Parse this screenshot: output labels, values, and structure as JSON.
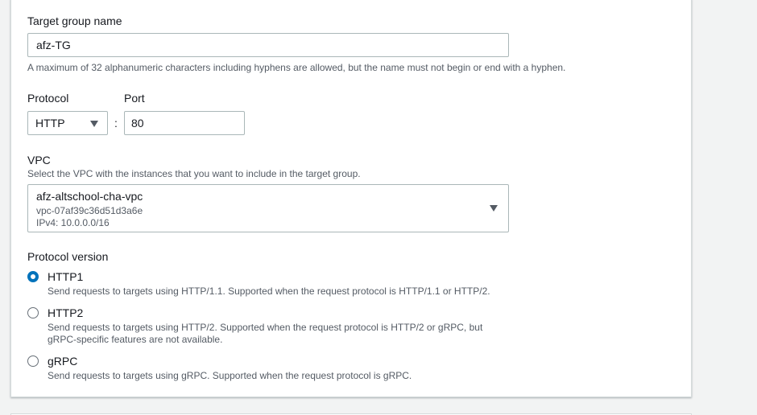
{
  "target_group_name": {
    "label": "Target group name",
    "value": "afz-TG",
    "hint": "A maximum of 32 alphanumeric characters including hyphens are allowed, but the name must not begin or end with a hyphen."
  },
  "protocol": {
    "label": "Protocol",
    "value": "HTTP"
  },
  "separator": ":",
  "port": {
    "label": "Port",
    "value": "80"
  },
  "vpc": {
    "label": "VPC",
    "hint": "Select the VPC with the instances that you want to include in the target group.",
    "selected_name": "afz-altschool-cha-vpc",
    "selected_id": "vpc-07af39c36d51d3a6e",
    "selected_cidr": "IPv4: 10.0.0.0/16"
  },
  "protocol_version": {
    "label": "Protocol version",
    "options": [
      {
        "label": "HTTP1",
        "description": "Send requests to targets using HTTP/1.1. Supported when the request protocol is HTTP/1.1 or HTTP/2.",
        "checked": true
      },
      {
        "label": "HTTP2",
        "description_line1": "Send requests to targets using HTTP/2. Supported when the request protocol is HTTP/2 or gRPC, but",
        "description_line2": "gRPC-specific features are not available.",
        "checked": false
      },
      {
        "label": "gRPC",
        "description": "Send requests to targets using gRPC. Supported when the request protocol is gRPC.",
        "checked": false
      }
    ]
  },
  "colors": {
    "accent": "#0073bb",
    "border": "#aab7b8",
    "hint": "#545b64"
  }
}
